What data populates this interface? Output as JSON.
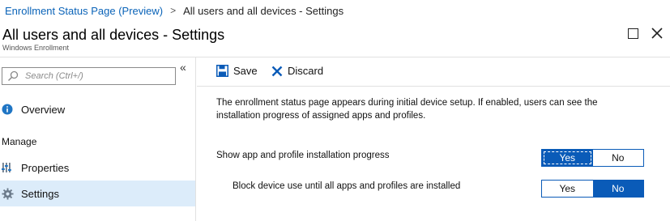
{
  "breadcrumb": {
    "parent": "Enrollment Status Page (Preview)",
    "separator": ">",
    "current": "All users and all devices - Settings"
  },
  "header": {
    "title": "All users and all devices - Settings",
    "subtitle": "Windows Enrollment"
  },
  "sidebar": {
    "collapse_glyph": "«",
    "search": {
      "placeholder": "Search (Ctrl+/)",
      "value": ""
    },
    "overview_label": "Overview",
    "section_manage": "Manage",
    "properties_label": "Properties",
    "settings_label": "Settings"
  },
  "toolbar": {
    "save_label": "Save",
    "discard_label": "Discard"
  },
  "content": {
    "description": "The enrollment status page appears during initial device setup. If enabled, users can see the installation progress of assigned apps and profiles.",
    "show_progress": {
      "label": "Show app and profile installation progress",
      "yes": "Yes",
      "no": "No",
      "selected": "Yes"
    },
    "block_device": {
      "label": "Block device use until all apps and profiles are installed",
      "yes": "Yes",
      "no": "No",
      "selected": "No"
    }
  },
  "colors": {
    "accent": "#0a5bb8",
    "link": "#0a63b8",
    "active_nav": "#dcecfa",
    "info_icon": "#1f75c4"
  }
}
